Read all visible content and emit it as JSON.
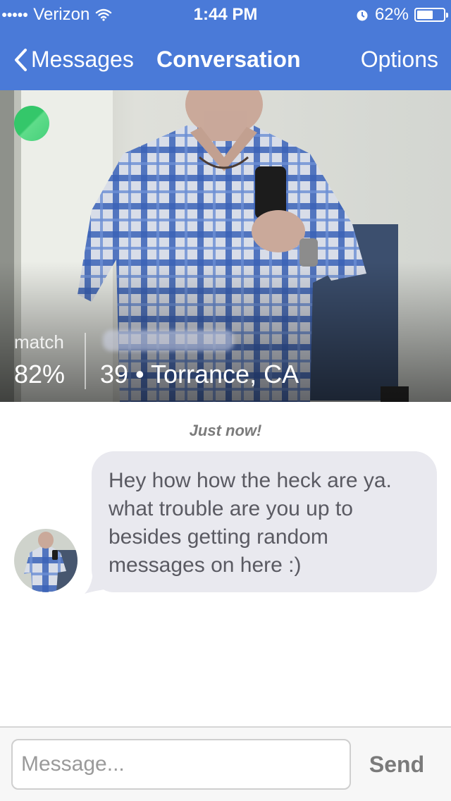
{
  "status_bar": {
    "carrier": "Verizon",
    "time": "1:44 PM",
    "battery_percent": "62%",
    "battery_level": 0.62,
    "signal_icon": "signal-dots-icon",
    "wifi_icon": "wifi-icon",
    "alarm_icon": "alarm-icon"
  },
  "nav": {
    "back_label": "Messages",
    "title": "Conversation",
    "options_label": "Options"
  },
  "profile": {
    "online_color": "#34c76a",
    "match_label": "match",
    "match_value": "82%",
    "age": "39",
    "location": "Torrance, CA",
    "age_location": "39 • Torrance, CA"
  },
  "conversation": {
    "timestamp": "Just now!",
    "messages": [
      {
        "lines": [
          "Hey how how the heck are ya.",
          "what trouble are you up to",
          "besides getting random",
          "messages on here :)"
        ]
      }
    ]
  },
  "composer": {
    "placeholder": "Message...",
    "send_label": "Send"
  },
  "colors": {
    "header": "#4a7ad8",
    "bubble": "#e9e9ef",
    "online": "#34c76a"
  }
}
